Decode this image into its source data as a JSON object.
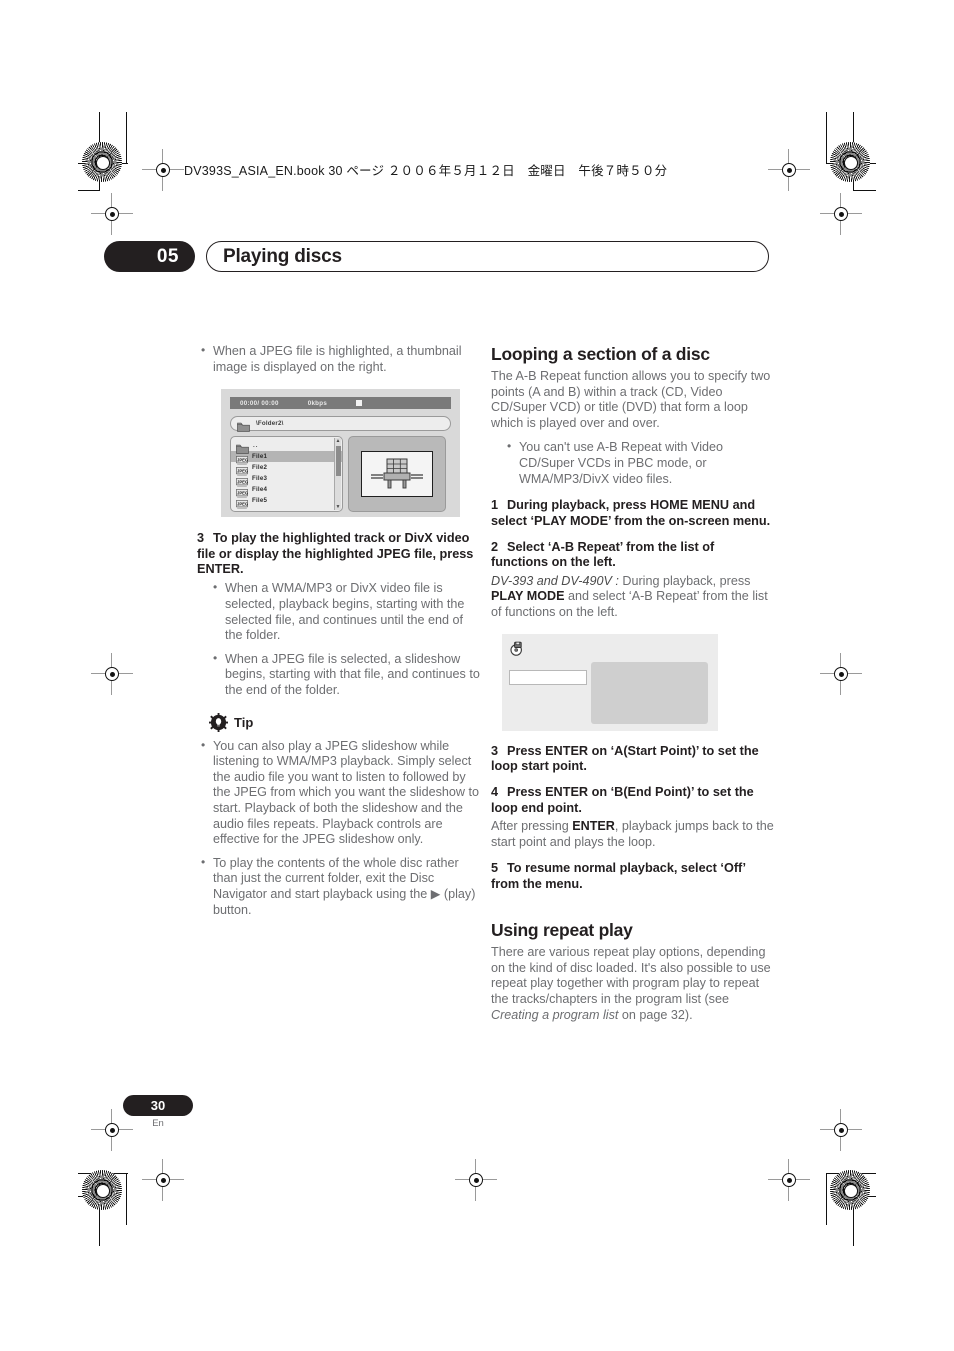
{
  "print": {
    "book_info": "DV393S_ASIA_EN.book  30 ページ  ２００６年５月１２日　金曜日　午後７時５０分"
  },
  "header": {
    "chapter_number": "05",
    "chapter_title": "Playing discs"
  },
  "left_column": {
    "bullet_top": "When a JPEG file is highlighted, a thumbnail image is displayed on the right.",
    "osd_navigator": {
      "time": "00:00/ 00:00",
      "bitrate": "0kbps",
      "status_icon": "stop-icon",
      "path": "\\Folder2\\",
      "parent_entry": "..",
      "files": [
        {
          "type": "JPEG",
          "name": "File1",
          "selected": true
        },
        {
          "type": "JPEG",
          "name": "File2",
          "selected": false
        },
        {
          "type": "JPEG",
          "name": "File3",
          "selected": false
        },
        {
          "type": "JPEG",
          "name": "File4",
          "selected": false
        },
        {
          "type": "JPEG",
          "name": "File5",
          "selected": false
        }
      ],
      "thumbnail_alt": "chair-photo-thumbnail"
    },
    "step3": {
      "number": "3",
      "text": "To play the highlighted track or DivX video file or display the highlighted JPEG file, press ENTER."
    },
    "step3_bullets": [
      "When a WMA/MP3 or DivX video file is selected, playback begins, starting with the selected file, and continues until the end of the folder.",
      "When a JPEG file is selected, a slideshow begins, starting with that file, and continues to the end of the folder."
    ],
    "tip": {
      "label": "Tip",
      "icon": "gear-tip-icon",
      "bullets": [
        "You can also play a JPEG slideshow while listening to WMA/MP3 playback. Simply select the audio file you want to listen to followed by the JPEG from which you want the slideshow to start. Playback of both the slideshow and the audio files repeats. Playback controls are effective for the JPEG slideshow only.",
        "To play the contents of the whole disc rather than just the current folder, exit the Disc Navigator and start playback using the ▶ (play) button."
      ]
    }
  },
  "right_column": {
    "section1_title": "Looping a section of a disc",
    "section1_para": "The A-B Repeat function allows you to specify two points (A and B) within a track (CD, Video CD/Super VCD) or title (DVD) that form a loop which is played over and over.",
    "section1_bullet": "You can't use A-B Repeat with Video CD/Super VCDs in PBC mode, or WMA/MP3/DivX video files.",
    "step1": {
      "number": "1",
      "text": "During playback, press HOME MENU and select ‘PLAY MODE’ from the on-screen menu."
    },
    "step2": {
      "number": "2",
      "text": "Select ‘A-B Repeat’ from the list of functions on the left."
    },
    "step2_note_model": "DV-393 and DV-490V :",
    "step2_note_a": " During playback, press ",
    "step2_note_bold": "PLAY MODE",
    "step2_note_b": " and select ‘A-B Repeat’ from the list of functions on the left.",
    "osd_playmode": {
      "icon": "play-mode-disc-icon"
    },
    "step3": {
      "number": "3",
      "text": "Press ENTER on ‘A(Start Point)’ to set the loop start point."
    },
    "step4": {
      "number": "4",
      "text": "Press ENTER on ‘B(End Point)’ to set the loop end point."
    },
    "step4_note_a": "After pressing ",
    "step4_note_bold": "ENTER",
    "step4_note_b": ", playback jumps back to the start point and plays the loop.",
    "step5": {
      "number": "5",
      "text": "To resume normal playback, select ‘Off’ from the menu."
    },
    "section2_title": "Using repeat play",
    "section2_para_a": "There are various repeat play options, depending on the kind of disc loaded. It's also possible to use repeat play together with program play to repeat the tracks/chapters in the program list (see ",
    "section2_para_italic": "Creating a program list",
    "section2_para_b": " on page 32)."
  },
  "footer": {
    "page_number": "30",
    "language": "En"
  },
  "colors": {
    "ink": "#231f20",
    "body_gray": "#6d6e71",
    "osd_bg": "#d9d9d9"
  }
}
